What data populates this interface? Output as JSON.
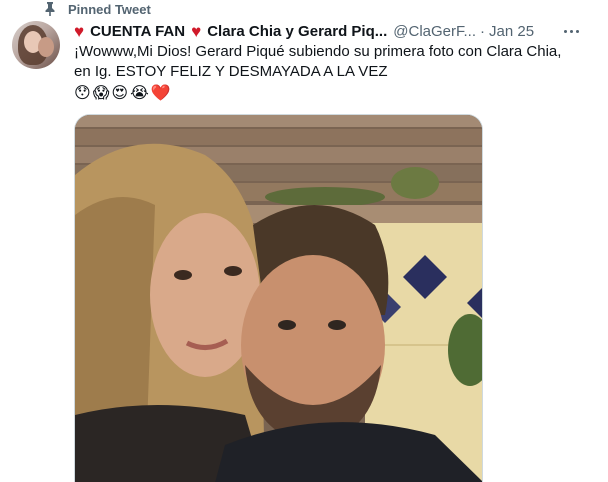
{
  "pinned": {
    "label": "Pinned Tweet",
    "icon": "pin-icon"
  },
  "author": {
    "heart_left": "♥",
    "name_part1": "CUENTA FAN",
    "heart_mid": "♥",
    "name_part2": "Clara Chia y Gerard Piq...",
    "handle": "@ClaGerF...",
    "separator": "·",
    "date": "Jan 25"
  },
  "tweet": {
    "text_line1": "¡Wowww,Mi Dios! Gerard Piqué subiendo su primera foto con Clara Chia,",
    "text_line2": "en Ig. ESTOY FELIZ Y DESMAYADA A LA VEZ",
    "emojis": [
      "😯",
      "😱",
      "😍",
      "😭",
      "❤️"
    ]
  },
  "media": {
    "icon": "photo-image"
  },
  "colors": {
    "text": "#0f1419",
    "secondary": "#536471",
    "heart": "#d01a2a",
    "border": "#cfd9de"
  }
}
